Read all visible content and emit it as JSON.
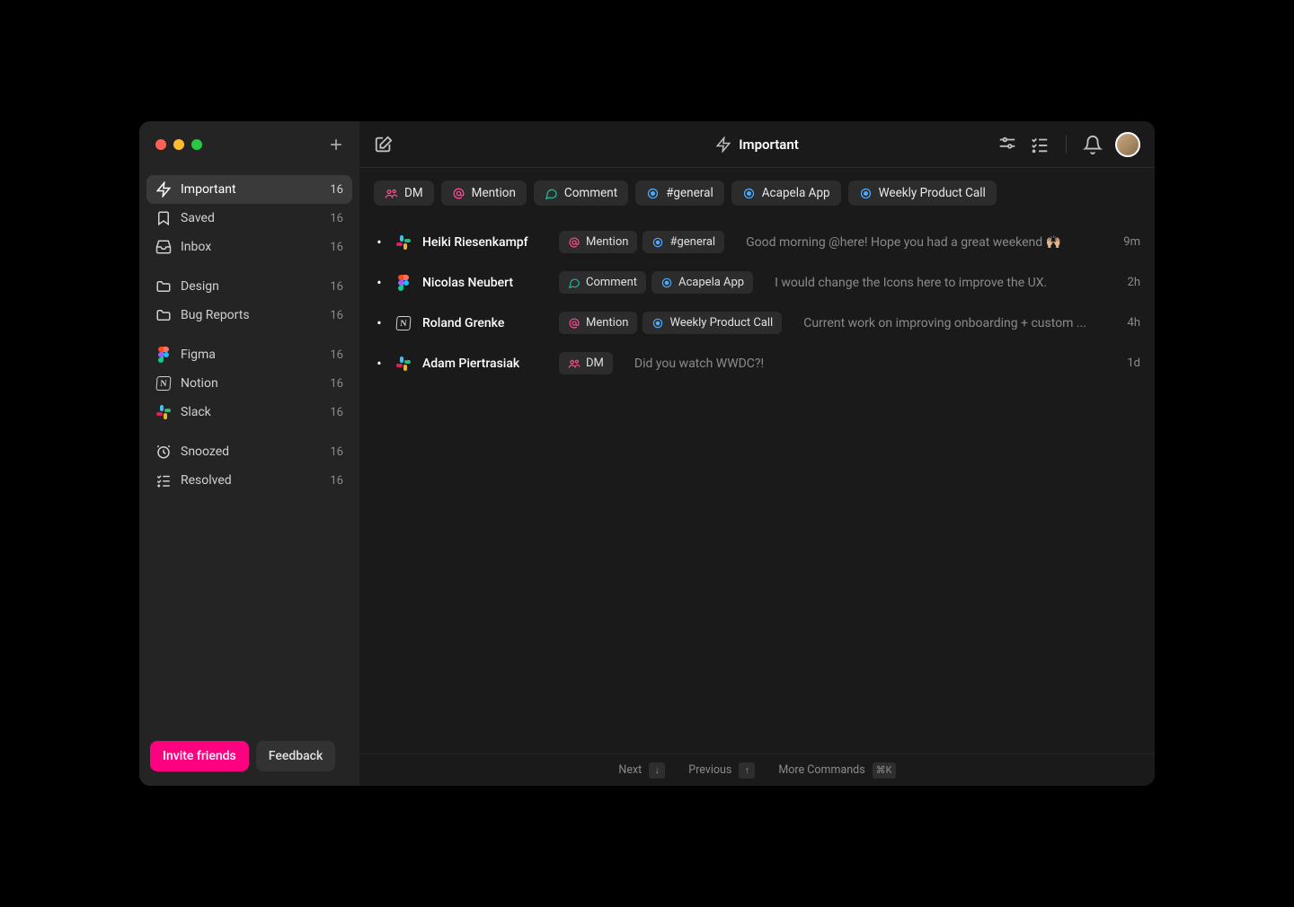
{
  "header": {
    "title": "Important"
  },
  "sidebar": {
    "groups": [
      {
        "items": [
          {
            "icon": "lightning",
            "label": "Important",
            "count": "16",
            "active": true
          },
          {
            "icon": "bookmark",
            "label": "Saved",
            "count": "16"
          },
          {
            "icon": "inbox",
            "label": "Inbox",
            "count": "16"
          }
        ]
      },
      {
        "items": [
          {
            "icon": "folder",
            "label": "Design",
            "count": "16"
          },
          {
            "icon": "folder",
            "label": "Bug Reports",
            "count": "16"
          }
        ]
      },
      {
        "items": [
          {
            "icon": "figma",
            "label": "Figma",
            "count": "16"
          },
          {
            "icon": "notion",
            "label": "Notion",
            "count": "16"
          },
          {
            "icon": "slack",
            "label": "Slack",
            "count": "16"
          }
        ]
      },
      {
        "items": [
          {
            "icon": "clock",
            "label": "Snoozed",
            "count": "16"
          },
          {
            "icon": "checklist",
            "label": "Resolved",
            "count": "16"
          }
        ]
      }
    ],
    "invite": "Invite friends",
    "feedback": "Feedback"
  },
  "filters": [
    {
      "icon": "dm",
      "color": "c-pink",
      "label": "DM"
    },
    {
      "icon": "mention",
      "color": "c-pink",
      "label": "Mention"
    },
    {
      "icon": "comment",
      "color": "c-teal",
      "label": "Comment"
    },
    {
      "icon": "target",
      "color": "c-blue",
      "label": "#general"
    },
    {
      "icon": "target",
      "color": "c-blue",
      "label": "Acapela App"
    },
    {
      "icon": "target",
      "color": "c-blue",
      "label": "Weekly Product Call"
    }
  ],
  "messages": [
    {
      "app": "slack",
      "sender": "Heiki Riesenkampf",
      "tags": [
        {
          "icon": "mention",
          "color": "c-pink",
          "label": "Mention"
        },
        {
          "icon": "target",
          "color": "c-blue",
          "label": "#general"
        }
      ],
      "preview": "Good morning @here! Hope you had a great weekend 🙌🏼",
      "time": "9m"
    },
    {
      "app": "figma",
      "sender": "Nicolas Neubert",
      "tags": [
        {
          "icon": "comment",
          "color": "c-teal",
          "label": "Comment"
        },
        {
          "icon": "target",
          "color": "c-blue",
          "label": "Acapela App"
        }
      ],
      "preview": "I would change the Icons here to improve the UX.",
      "time": "2h"
    },
    {
      "app": "notion",
      "sender": "Roland Grenke",
      "tags": [
        {
          "icon": "mention",
          "color": "c-pink",
          "label": "Mention"
        },
        {
          "icon": "target",
          "color": "c-blue",
          "label": "Weekly Product Call"
        }
      ],
      "preview": "Current work on improving onboarding + custom ...",
      "time": "4h"
    },
    {
      "app": "slack",
      "sender": "Adam Piertrasiak",
      "tags": [
        {
          "icon": "dm",
          "color": "c-pink",
          "label": "DM"
        }
      ],
      "preview": "Did you watch WWDC?!",
      "time": "1d"
    }
  ],
  "bottombar": {
    "next": "Next",
    "next_key": "↓",
    "prev": "Previous",
    "prev_key": "↑",
    "more": "More Commands",
    "more_key": "⌘K"
  }
}
